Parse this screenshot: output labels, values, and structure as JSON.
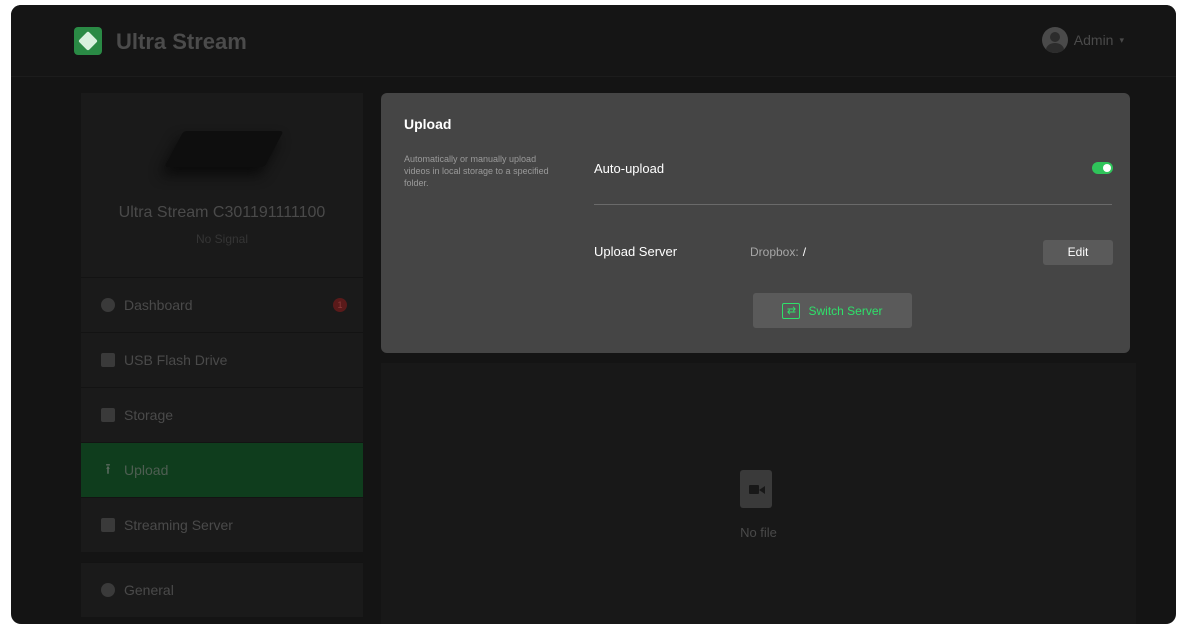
{
  "header": {
    "app_title": "Ultra Stream",
    "user_name": "Admin"
  },
  "device": {
    "name": "Ultra Stream C301191111100",
    "status": "No Signal"
  },
  "nav": {
    "dashboard": "Dashboard",
    "dashboard_badge": "1",
    "usb": "USB Flash Drive",
    "storage": "Storage",
    "upload": "Upload",
    "streaming": "Streaming Server",
    "general": "General"
  },
  "upload_panel": {
    "title": "Upload",
    "description": "Automatically or manually upload videos in local storage to a specified folder.",
    "auto_upload_label": "Auto-upload",
    "auto_upload_enabled": true,
    "upload_server_label": "Upload Server",
    "server_provider": "Dropbox:",
    "server_path": "/",
    "edit_label": "Edit",
    "switch_label": "Switch Server"
  },
  "files": {
    "empty_text": "No file"
  },
  "colors": {
    "accent": "#2fc45a",
    "active_nav": "#0f3d1d"
  }
}
